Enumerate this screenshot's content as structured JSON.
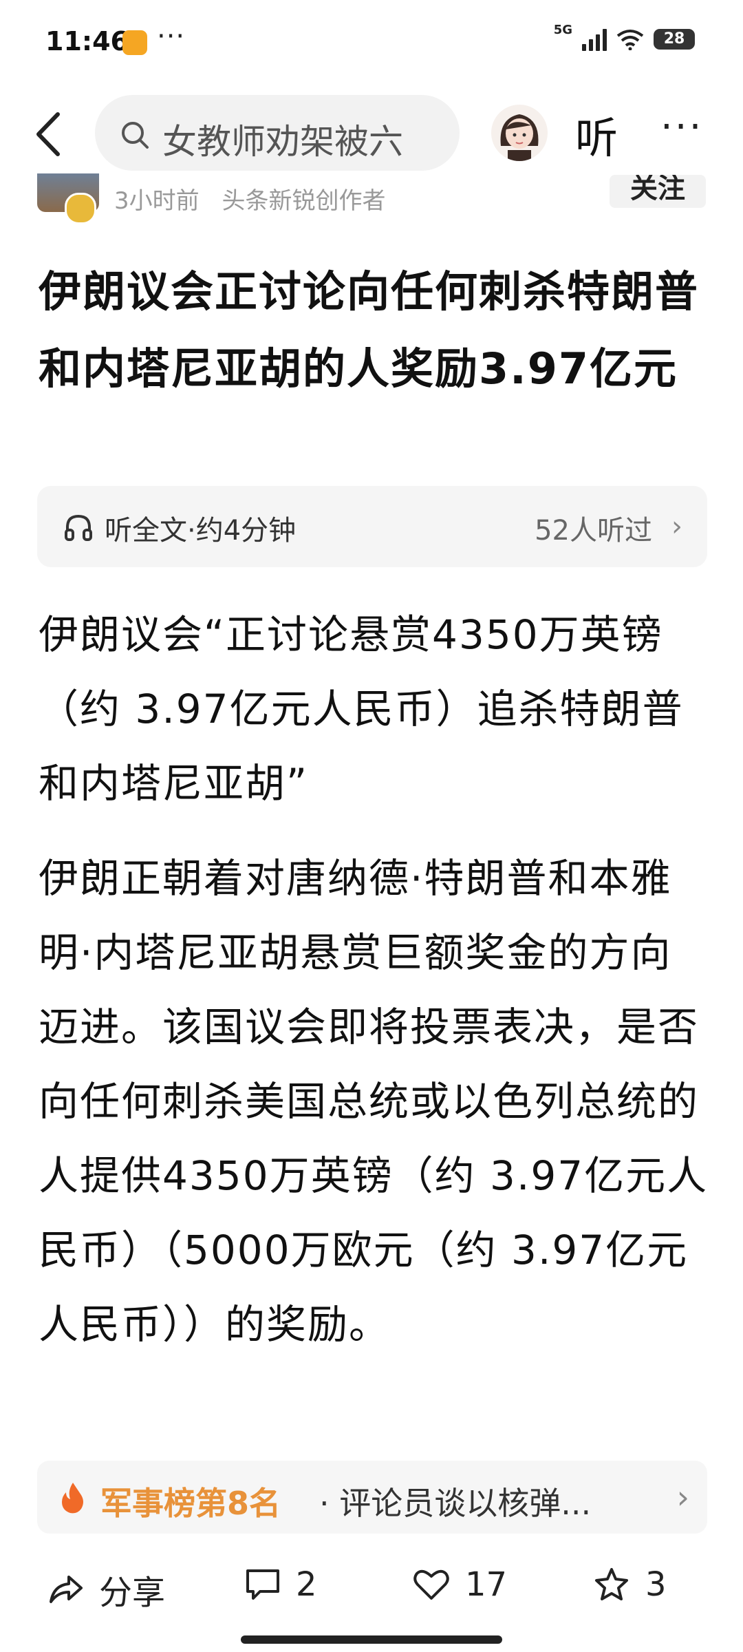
{
  "status_bar": {
    "time": "11:46",
    "dots": "···",
    "signal_label": "5G",
    "battery": "28"
  },
  "nav": {
    "search_text": "女教师劝架被六",
    "listen_label": "听",
    "more": "···"
  },
  "author": {
    "time_ago": "3小时前",
    "tag": "头条新锐创作者",
    "follow_label": "关注"
  },
  "article": {
    "title": "伊朗议会正讨论向任何刺杀特朗普和内塔尼亚胡的人奖励3.97亿元",
    "listen_full": "听全文·约4分钟",
    "listen_count": "52人听过",
    "paragraphs": [
      "伊朗议会“正讨论悬赏4350万英镑（约 3.97亿元人民币）追杀特朗普和内塔尼亚胡”",
      "伊朗正朝着对唐纳德·特朗普和本雅明·内塔尼亚胡悬赏巨额奖金的方向迈进。该国议会即将投票表决，是否向任何刺杀美国总统或以色列总统的人提供4350万英镑（约 3.97亿元人民币）（5000万欧元（约 3.97亿元人民币））的奖励。"
    ]
  },
  "ranking": {
    "label": "军事榜第8名",
    "text": "· 评论员谈以核弹..."
  },
  "actions": {
    "share_label": "分享",
    "comment_count": "2",
    "like_count": "17",
    "favorite_count": "3"
  },
  "colors": {
    "accent_orange": "#e8923a",
    "text_primary": "#111111"
  }
}
